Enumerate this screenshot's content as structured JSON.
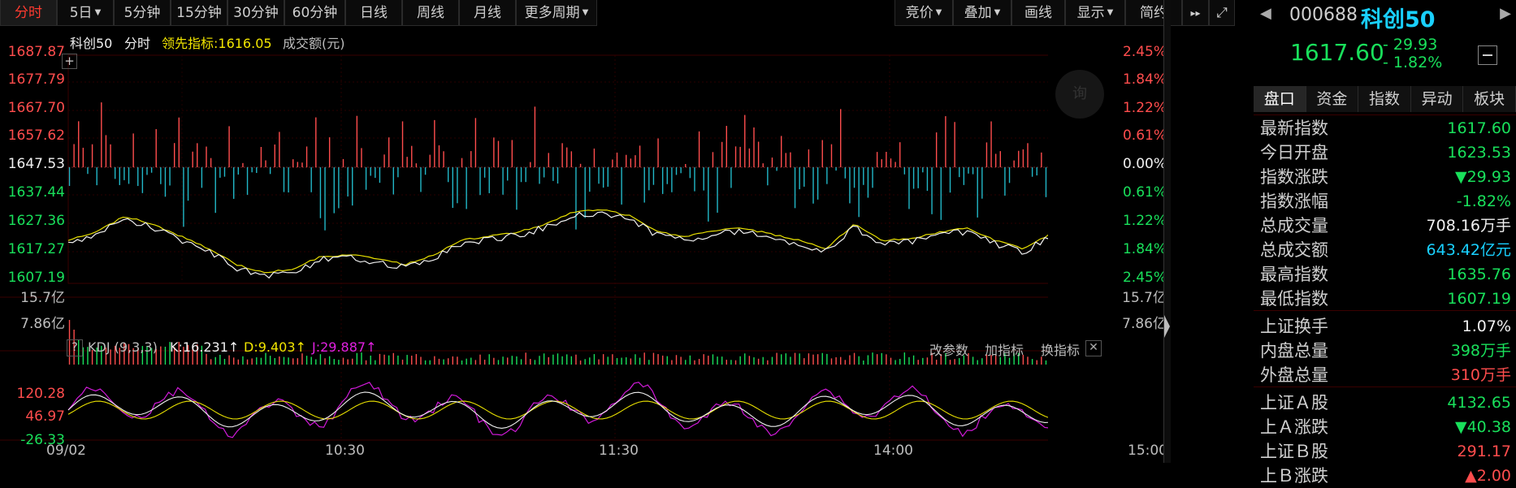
{
  "toolbar": {
    "left_buttons": [
      "分时",
      "5日",
      "5分钟",
      "15分钟",
      "30分钟",
      "60分钟",
      "日线",
      "周线",
      "月线",
      "更多周期"
    ],
    "right_buttons": [
      "竞价",
      "叠加",
      "画线",
      "显示",
      "简约"
    ],
    "more_icon": "double-chevron-right-icon",
    "fullscreen_icon": "expand-icon"
  },
  "legend": {
    "name": "科创50",
    "mode": "分时",
    "lead_label": "领先指标:1616.05",
    "volume_label": "成交额(元)"
  },
  "price_axis_left": [
    "1687.87",
    "1677.79",
    "1667.70",
    "1657.62",
    "1647.53",
    "1637.44",
    "1627.36",
    "1617.27",
    "1607.19"
  ],
  "price_axis_right": [
    "2.45%",
    "1.84%",
    "1.22%",
    "0.61%",
    "0.00%",
    "0.61%",
    "1.22%",
    "1.84%",
    "2.45%"
  ],
  "volume_axis": [
    "15.7亿",
    "7.86亿"
  ],
  "kdj": {
    "help": "?",
    "name": "KDJ (9,3,3)",
    "k": "K:16.231↑",
    "d": "D:9.403↑",
    "j": "J:29.887↑",
    "actions": [
      "改参数",
      "加指标",
      "换指标"
    ],
    "axis": [
      "120.28",
      "46.97",
      "-26.33"
    ]
  },
  "time_axis": [
    "09/02",
    "10:30",
    "11:30",
    "14:00",
    "15:00"
  ],
  "watermark": "询",
  "colors": {
    "up": "#ff4d4d",
    "down": "#19e05b",
    "bar_down": "#22b8c8",
    "price_line": "#f0f0f0",
    "avg_line": "#e8e000",
    "j_line": "#d01ad8"
  },
  "quote": {
    "code": "000688",
    "name": "科创50",
    "price": "1617.60",
    "change": "- 29.93",
    "change_pct": "- 1.82%"
  },
  "tabs": [
    "盘口",
    "资金",
    "指数",
    "异动",
    "板块"
  ],
  "stats": [
    {
      "k": "最新指数",
      "v": "1617.60",
      "c": "green"
    },
    {
      "k": "今日开盘",
      "v": "1623.53",
      "c": "green"
    },
    {
      "k": "指数涨跌",
      "v": "▼29.93",
      "c": "green"
    },
    {
      "k": "指数涨幅",
      "v": "-1.82%",
      "c": "green"
    },
    {
      "k": "总成交量",
      "v": "708.16万手",
      "c": "white"
    },
    {
      "k": "总成交额",
      "v": "643.42亿元",
      "c": "cyan"
    },
    {
      "k": "最高指数",
      "v": "1635.76",
      "c": "green"
    },
    {
      "k": "最低指数",
      "v": "1607.19",
      "c": "green"
    },
    {
      "k": "上证换手",
      "v": "1.07%",
      "c": "white"
    },
    {
      "k": "内盘总量",
      "v": "398万手",
      "c": "green"
    },
    {
      "k": "外盘总量",
      "v": "310万手",
      "c": "red"
    },
    {
      "k": "上证Ａ股",
      "v": "4132.65",
      "c": "green"
    },
    {
      "k": "上Ａ涨跌",
      "v": "▼40.38",
      "c": "green"
    },
    {
      "k": "上证Ｂ股",
      "v": "291.17",
      "c": "red"
    },
    {
      "k": "上Ｂ涨跌",
      "v": "▲2.00",
      "c": "red"
    }
  ]
}
